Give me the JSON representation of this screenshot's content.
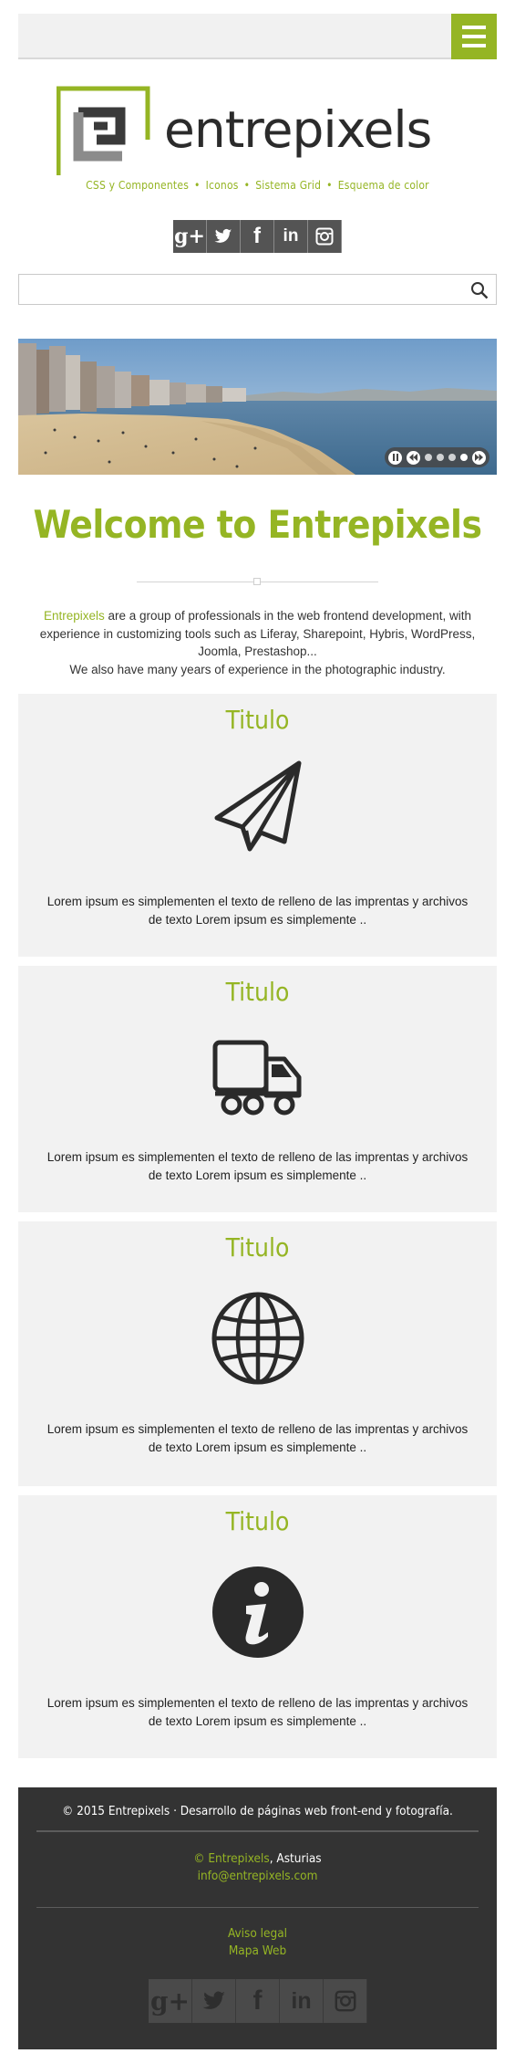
{
  "brand": {
    "name": "entrepixels",
    "accent": "#95b524"
  },
  "tagline": [
    "CSS y Componentes",
    "Iconos",
    "Sistema Grid",
    "Esquema de color"
  ],
  "social": [
    "google-plus-icon",
    "twitter-icon",
    "facebook-icon",
    "linkedin-icon",
    "instagram-icon"
  ],
  "search": {
    "value": "",
    "placeholder": ""
  },
  "welcome": {
    "title": "Welcome to Entrepixels"
  },
  "intro": {
    "link": "Entrepixels",
    "text": " are a group of professionals in the web frontend development, with experience in customizing tools such as Liferay, Sharepoint, Hybris, WordPress, Joomla, Prestashop...",
    "text2": "We also have many years of experience in the photographic industry."
  },
  "cards": [
    {
      "title": "Titulo",
      "icon": "paper-plane-icon",
      "text": "Lorem ipsum es simplementen el texto de relleno de las imprentas y archivos de texto Lorem ipsum es simplemente .."
    },
    {
      "title": "Titulo",
      "icon": "truck-icon",
      "text": "Lorem ipsum es simplementen el texto de relleno de las imprentas y archivos de texto Lorem ipsum es simplemente .."
    },
    {
      "title": "Titulo",
      "icon": "globe-icon",
      "text": "Lorem ipsum es simplementen el texto de relleno de las imprentas y archivos de texto Lorem ipsum es simplemente .."
    },
    {
      "title": "Titulo",
      "icon": "info-icon",
      "text": "Lorem ipsum es simplementen el texto de relleno de las imprentas y archivos de texto Lorem ipsum es simplemente .."
    }
  ],
  "footer": {
    "copyright": "© 2015 Entrepixels · Desarrollo de páginas web front-end y fotografía.",
    "company_link": "© Entrepixels",
    "location": ", Asturias",
    "email": "info@entrepixels.com",
    "legal": "Aviso legal",
    "sitemap": "Mapa Web"
  }
}
